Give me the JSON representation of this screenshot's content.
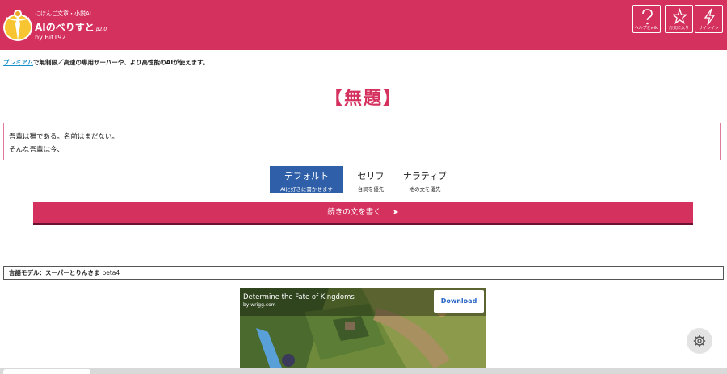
{
  "header": {
    "tagline": "にほんご文章・小説AI",
    "app_name": "AIのべりすと",
    "beta": "β2.0",
    "by": "by Bit192",
    "buttons": [
      {
        "label": "ヘルプとwiki",
        "icon": "question-icon"
      },
      {
        "label": "お気に入り",
        "icon": "star-icon"
      },
      {
        "label": "サインイン",
        "icon": "lightning-icon"
      }
    ],
    "brand_color": "#d5315f"
  },
  "premium": {
    "link": "プレミアム",
    "text": "で無制限／高速の専用サーバーや、より高性能のAIが使えます。"
  },
  "story": {
    "title": "【無題】",
    "lines": [
      "吾輩は猫である。名前はまだない。",
      "そんな吾輩は今、"
    ]
  },
  "modes": [
    {
      "label": "デフォルト",
      "sub": "AIに好きに書かせます",
      "active": true
    },
    {
      "label": "セリフ",
      "sub": "台詞を優先",
      "active": false
    },
    {
      "label": "ナラティブ",
      "sub": "地の文を優先",
      "active": false
    }
  ],
  "continue_button": {
    "label": "続きの文を書く",
    "arrow": "➤"
  },
  "model": {
    "label": "言語モデル：",
    "name": "スーパーとりんさま",
    "beta": "beta4"
  },
  "ad": {
    "title": "Determine the Fate of Kingdoms",
    "subtitle": "by wrigg.com",
    "download": "Download"
  },
  "settings": {
    "icon": "gear-icon"
  }
}
